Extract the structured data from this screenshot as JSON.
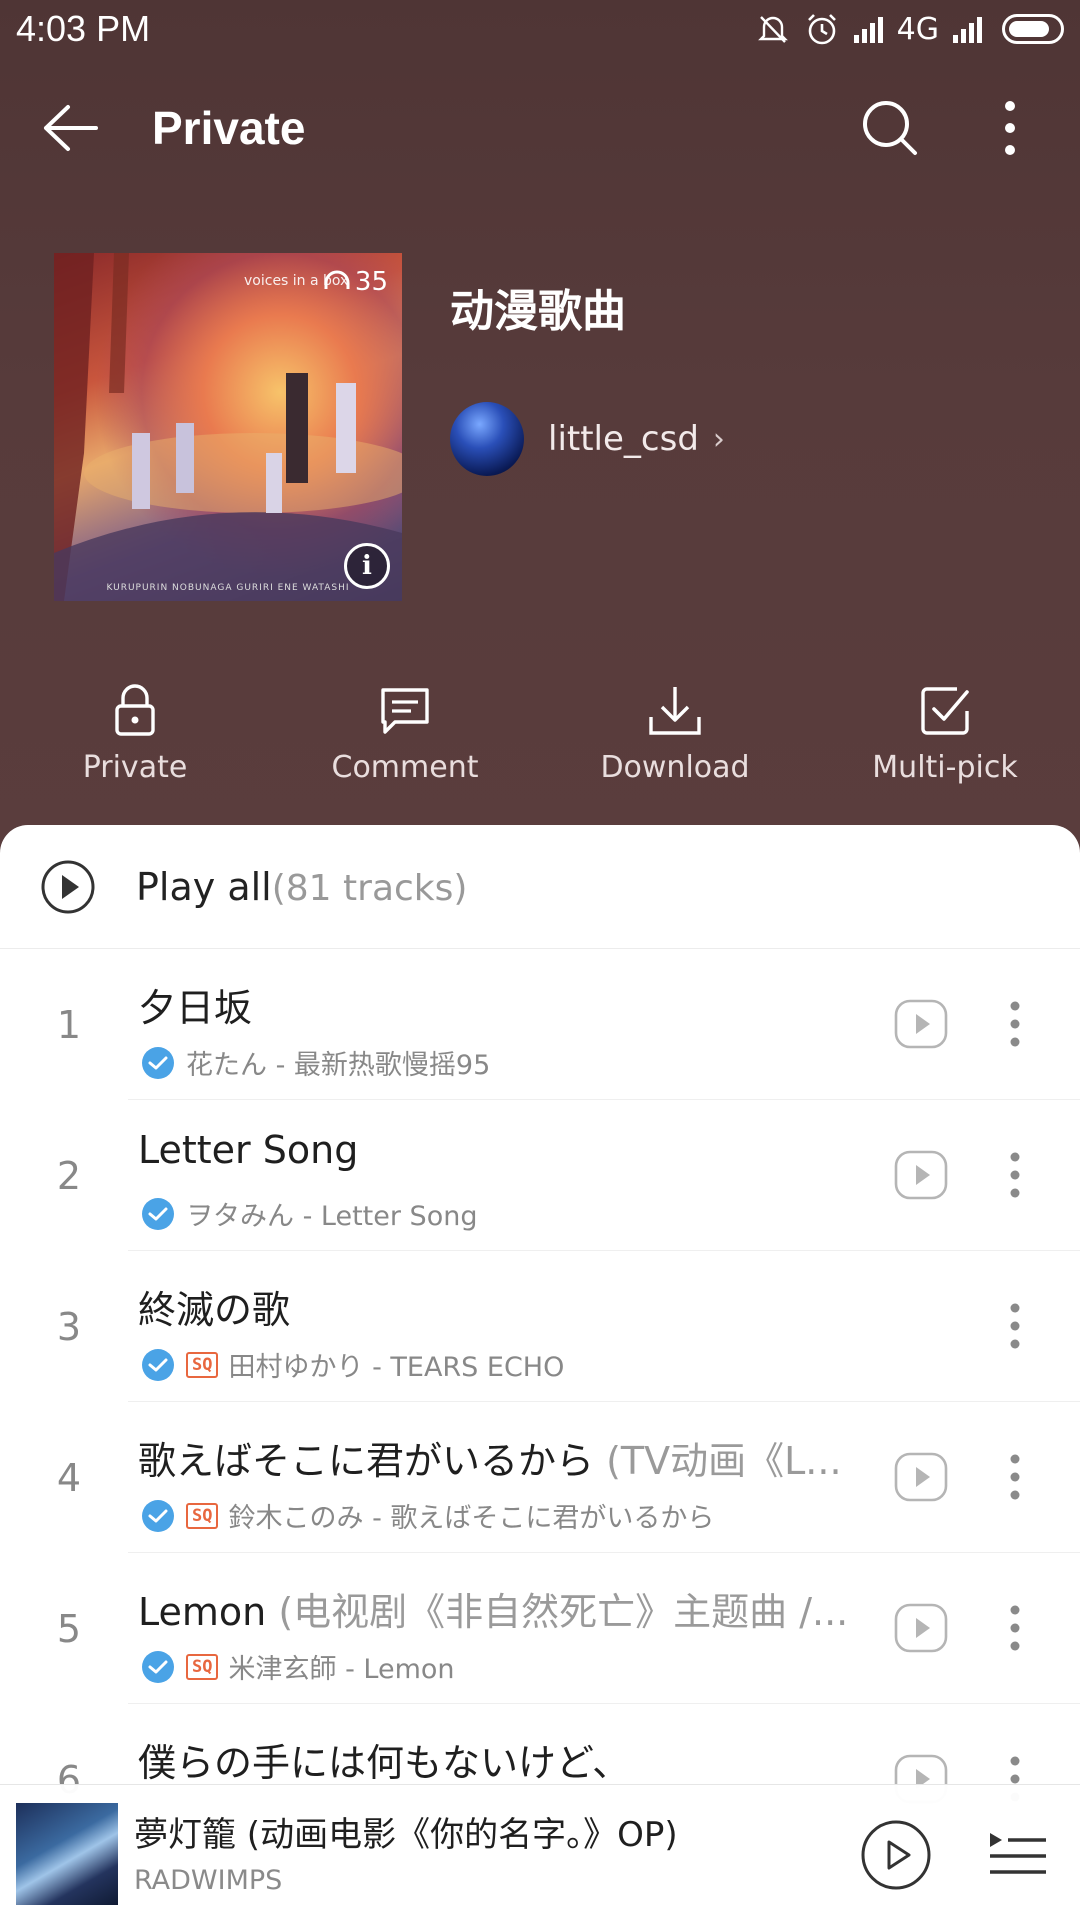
{
  "status_bar": {
    "time": "4:03 PM",
    "network": "4G"
  },
  "app_bar": {
    "title": "Private"
  },
  "playlist": {
    "cover_caption": "voices in a box",
    "cover_count": "35",
    "cover_credit": "KURUPURIN NOBUNAGA GURIRI ENE WATASHI",
    "title": "动漫歌曲",
    "owner": "little_csd",
    "owner_chevron": "›"
  },
  "actions": [
    {
      "label": "Private",
      "icon": "lock-icon"
    },
    {
      "label": "Comment",
      "icon": "comment-icon"
    },
    {
      "label": "Download",
      "icon": "download-icon"
    },
    {
      "label": "Multi-pick",
      "icon": "checkbox-icon"
    }
  ],
  "play_all": {
    "label": "Play all",
    "count": "(81 tracks)"
  },
  "tracks": [
    {
      "num": "1",
      "title": "夕日坂",
      "subtitle": "",
      "sq": false,
      "meta": "花たん - 最新热歌慢摇95",
      "has_play": true
    },
    {
      "num": "2",
      "title": "Letter Song",
      "subtitle": "",
      "sq": false,
      "meta": "ヲタみん - Letter Song",
      "has_play": true
    },
    {
      "num": "3",
      "title": "終滅の歌",
      "subtitle": "",
      "sq": true,
      "meta": "田村ゆかり - TEARS ECHO",
      "has_play": false
    },
    {
      "num": "4",
      "title": "歌えばそこに君がいるから ",
      "subtitle": "(TV动画《L...",
      "sq": true,
      "meta": "鈴木このみ - 歌えばそこに君がいるから",
      "has_play": true
    },
    {
      "num": "5",
      "title": "Lemon ",
      "subtitle": "(电视剧《非自然死亡》主题曲 /...",
      "sq": true,
      "meta": "米津玄師 - Lemon",
      "has_play": true
    },
    {
      "num": "6",
      "title": "僕らの手には何もないけど、",
      "subtitle": "",
      "sq": false,
      "meta": "",
      "has_play": true
    }
  ],
  "sq_label": "SQ",
  "mini_player": {
    "title": "夢灯籠 (动画电影《你的名字。》OP)",
    "artist": "RADWIMPS"
  },
  "colors": {
    "header_bg": "#573b3b",
    "accent_blue": "#4aa3e6",
    "sq_orange": "#e8673f"
  }
}
